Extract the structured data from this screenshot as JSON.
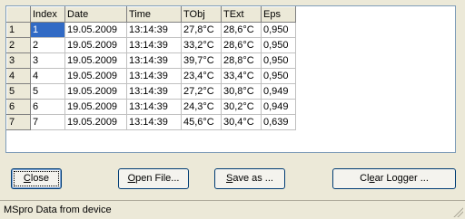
{
  "grid": {
    "columns": [
      "",
      "Index",
      "Date",
      "Time",
      "TObj",
      "TExt",
      "Eps"
    ],
    "rows": [
      {
        "row": "1",
        "index": "1",
        "date": "19.05.2009",
        "time": "13:14:39",
        "tobj": "27,8°C",
        "text": "28,6°C",
        "eps": "0,950"
      },
      {
        "row": "2",
        "index": "2",
        "date": "19.05.2009",
        "time": "13:14:39",
        "tobj": "33,2°C",
        "text": "28,6°C",
        "eps": "0,950"
      },
      {
        "row": "3",
        "index": "3",
        "date": "19.05.2009",
        "time": "13:14:39",
        "tobj": "39,7°C",
        "text": "28,8°C",
        "eps": "0,950"
      },
      {
        "row": "4",
        "index": "4",
        "date": "19.05.2009",
        "time": "13:14:39",
        "tobj": "23,4°C",
        "text": "33,4°C",
        "eps": "0,950"
      },
      {
        "row": "5",
        "index": "5",
        "date": "19.05.2009",
        "time": "13:14:39",
        "tobj": "27,2°C",
        "text": "30,8°C",
        "eps": "0,949"
      },
      {
        "row": "6",
        "index": "6",
        "date": "19.05.2009",
        "time": "13:14:39",
        "tobj": "24,3°C",
        "text": "30,2°C",
        "eps": "0,949"
      },
      {
        "row": "7",
        "index": "7",
        "date": "19.05.2009",
        "time": "13:14:39",
        "tobj": "45,6°C",
        "text": "30,4°C",
        "eps": "0,639"
      }
    ]
  },
  "buttons": {
    "close": {
      "mnemonic": "C",
      "rest": "lose"
    },
    "open_file": {
      "mnemonic": "O",
      "rest": "pen File..."
    },
    "save_as": {
      "mnemonic": "S",
      "rest": "ave as ..."
    },
    "clear_logger": {
      "pre": "Cl",
      "mnemonic": "e",
      "rest": "ar Logger ..."
    }
  },
  "status": {
    "text": "MSpro Data from device"
  }
}
